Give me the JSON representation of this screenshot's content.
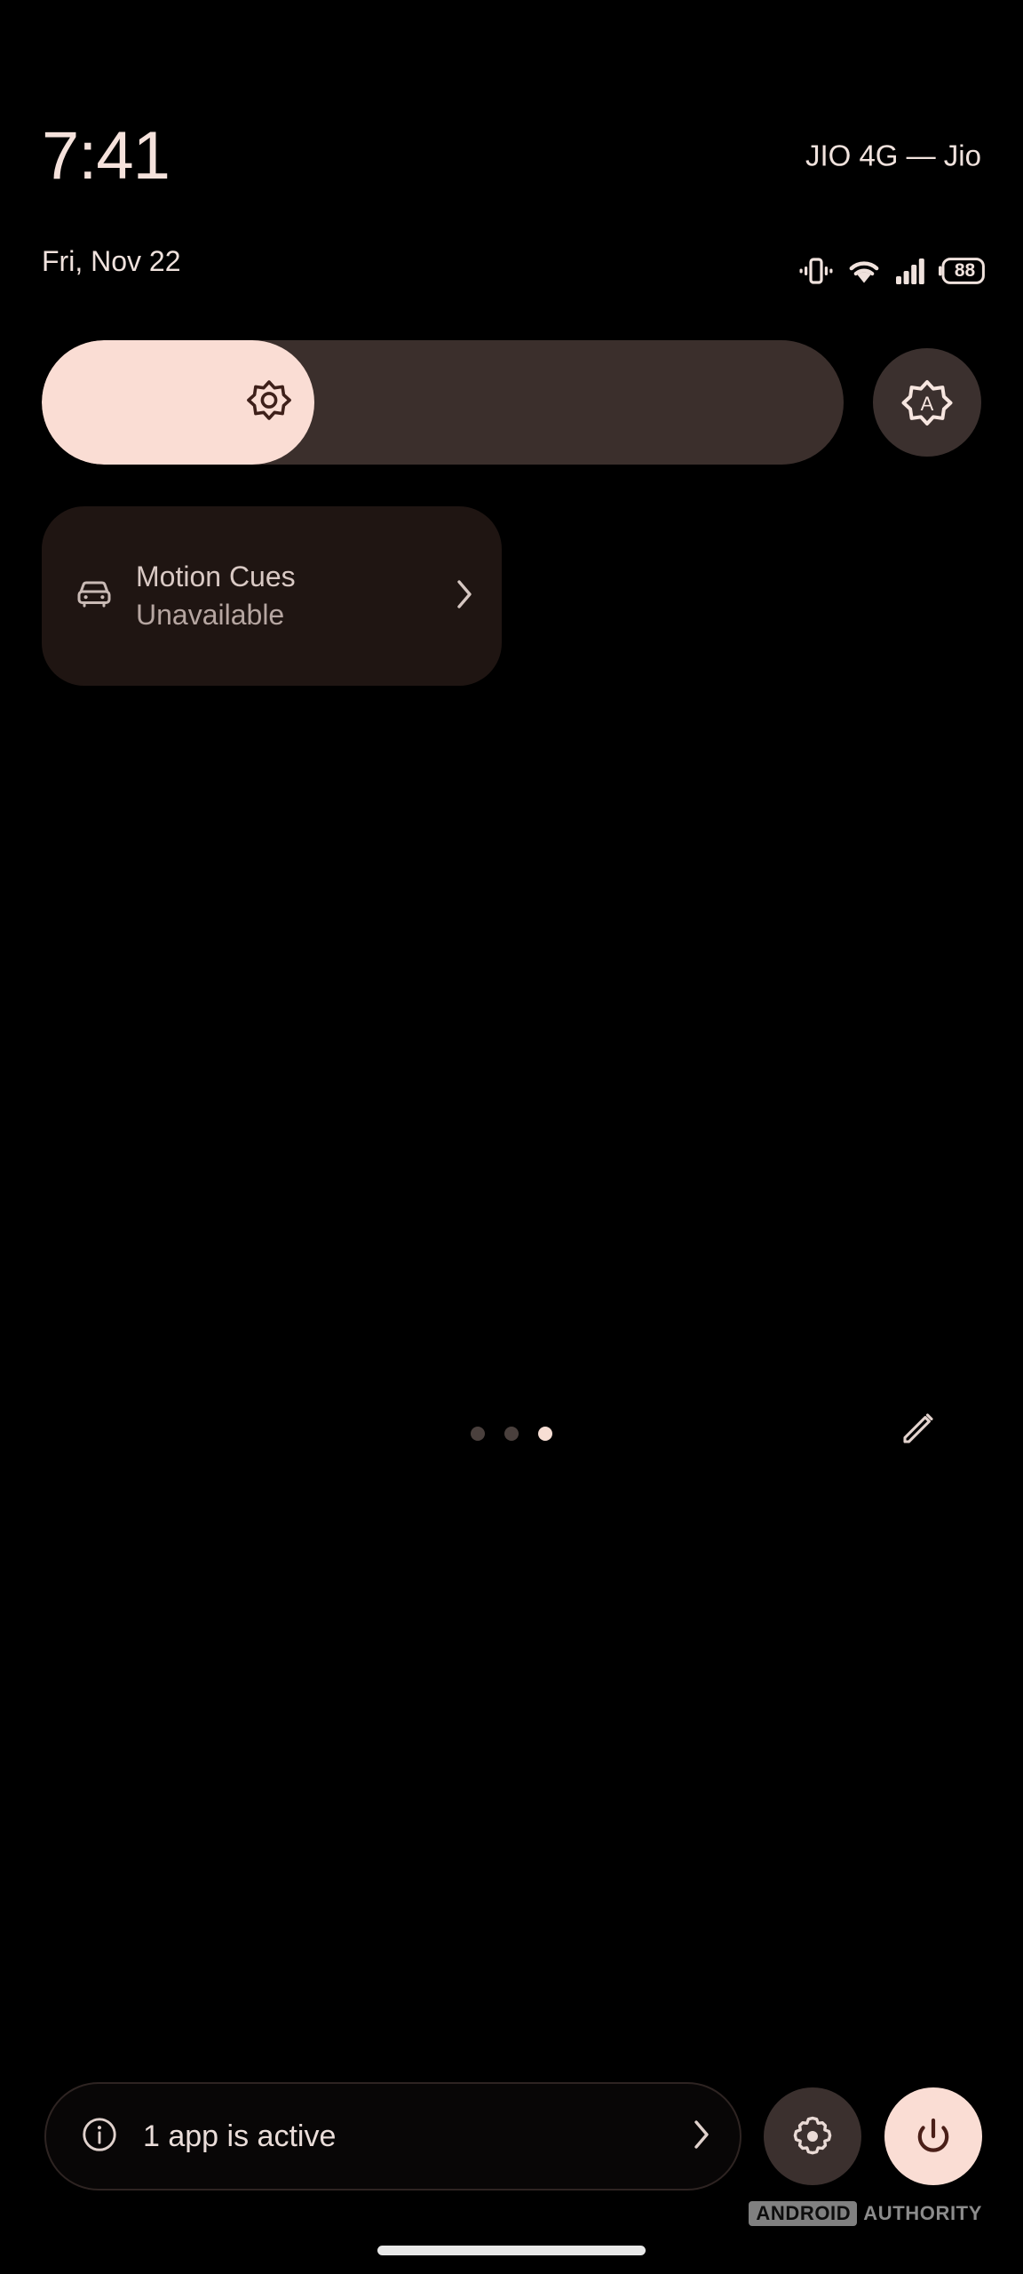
{
  "status_bar": {
    "clock": "7:41",
    "date": "Fri, Nov 22",
    "carrier": "JIO 4G — Jio",
    "battery_percent": "88",
    "icons": [
      "vibrate-icon",
      "wifi-icon",
      "cellular-signal-icon",
      "battery-icon"
    ]
  },
  "brightness": {
    "slider_name": "brightness-slider",
    "level_percent": 34,
    "icon": "brightness-icon",
    "auto_button": {
      "name": "auto-brightness-button",
      "icon": "auto-brightness-icon",
      "letter": "A"
    }
  },
  "tiles": [
    {
      "id": "motion-cues",
      "title": "Motion Cues",
      "subtitle": "Unavailable",
      "icon": "car-icon",
      "chevron": "chevron-right-icon"
    }
  ],
  "pager": {
    "total": 3,
    "active_index": 2
  },
  "edit": {
    "icon": "pencil-icon",
    "name": "edit-tiles-button"
  },
  "footer": {
    "active_apps_label": "1 app is active",
    "info_icon": "info-icon",
    "chevron": "chevron-right-icon",
    "settings_icon": "gear-icon",
    "power_icon": "power-icon"
  },
  "watermark": {
    "badge": "ANDROID",
    "text": "AUTHORITY"
  },
  "colors": {
    "background": "#000000",
    "accent_pink": "#FADDD4",
    "track_brown": "#3B2F2C",
    "tile_brown": "#1F1512",
    "button_brown": "#3B302E",
    "text_primary": "#F0E2DD",
    "text_secondary": "#B6A6A1",
    "icon_dark": "#3E201A"
  }
}
